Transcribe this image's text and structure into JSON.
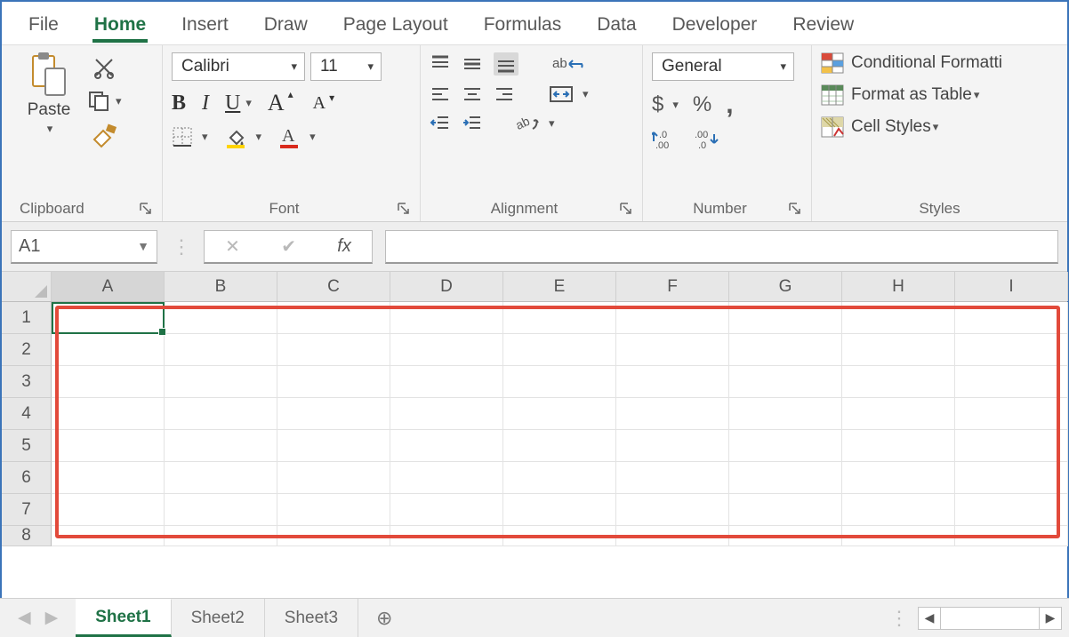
{
  "tabs": {
    "items": [
      "File",
      "Home",
      "Insert",
      "Draw",
      "Page Layout",
      "Formulas",
      "Data",
      "Developer",
      "Review"
    ],
    "activeIndex": 1
  },
  "ribbon": {
    "clipboard": {
      "paste_label": "Paste",
      "group_label": "Clipboard"
    },
    "font": {
      "group_label": "Font",
      "font_name": "Calibri",
      "font_size": "11",
      "bold": "B",
      "italic": "I",
      "underline": "U",
      "grow": "A",
      "shrink": "A"
    },
    "alignment": {
      "group_label": "Alignment",
      "wrap": "ab"
    },
    "number": {
      "group_label": "Number",
      "format": "General",
      "currency": "$",
      "percent": "%",
      "comma": ","
    },
    "styles": {
      "group_label": "Styles",
      "conditional": "Conditional Formatti",
      "table": "Format as Table",
      "cell": "Cell Styles"
    }
  },
  "fbar": {
    "namebox": "A1",
    "fx": "fx",
    "formula": ""
  },
  "grid": {
    "columns": [
      "A",
      "B",
      "C",
      "D",
      "E",
      "F",
      "G",
      "H",
      "I"
    ],
    "rows": [
      "1",
      "2",
      "3",
      "4",
      "5",
      "6",
      "7",
      "8"
    ],
    "active_cell": "A1"
  },
  "sheets": {
    "items": [
      "Sheet1",
      "Sheet2",
      "Sheet3"
    ],
    "activeIndex": 0
  }
}
